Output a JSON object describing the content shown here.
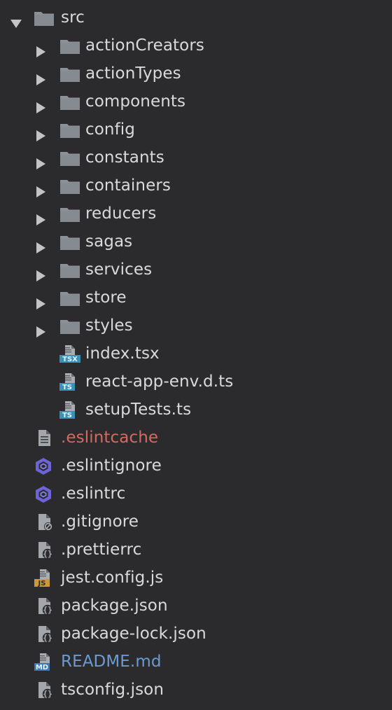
{
  "tree": {
    "root": {
      "name": "src",
      "icon": "folder-icon",
      "expanded": true
    },
    "folders": [
      {
        "name": "actionCreators",
        "icon": "folder-icon"
      },
      {
        "name": "actionTypes",
        "icon": "folder-icon"
      },
      {
        "name": "components",
        "icon": "folder-icon"
      },
      {
        "name": "config",
        "icon": "folder-icon"
      },
      {
        "name": "constants",
        "icon": "folder-icon"
      },
      {
        "name": "containers",
        "icon": "folder-icon"
      },
      {
        "name": "reducers",
        "icon": "folder-icon"
      },
      {
        "name": "sagas",
        "icon": "folder-icon"
      },
      {
        "name": "services",
        "icon": "folder-icon"
      },
      {
        "name": "store",
        "icon": "folder-icon"
      },
      {
        "name": "styles",
        "icon": "folder-icon"
      }
    ],
    "src_files": [
      {
        "name": "index.tsx",
        "icon": "tsx-file-icon",
        "badge": "TSX"
      },
      {
        "name": "react-app-env.d.ts",
        "icon": "ts-file-icon",
        "badge": "TS"
      },
      {
        "name": "setupTests.ts",
        "icon": "ts-file-icon",
        "badge": "TS"
      }
    ],
    "root_files": [
      {
        "name": ".eslintcache",
        "icon": "text-file-icon",
        "status": "unversioned"
      },
      {
        "name": ".eslintignore",
        "icon": "eslint-icon"
      },
      {
        "name": ".eslintrc",
        "icon": "eslint-icon"
      },
      {
        "name": ".gitignore",
        "icon": "ignore-file-icon"
      },
      {
        "name": ".prettierrc",
        "icon": "json-file-icon"
      },
      {
        "name": "jest.config.js",
        "icon": "js-file-icon",
        "badge": "JS"
      },
      {
        "name": "package.json",
        "icon": "json-file-icon"
      },
      {
        "name": "package-lock.json",
        "icon": "json-file-icon"
      },
      {
        "name": "README.md",
        "icon": "md-file-icon",
        "badge": "MD",
        "status": "modified"
      },
      {
        "name": "tsconfig.json",
        "icon": "json-file-icon"
      }
    ]
  },
  "colors": {
    "background": "#2b2b2d",
    "text": "#dadada",
    "unversioned": "#d6695f",
    "modified": "#6b9bd1",
    "folder": "#8b9196",
    "ts_badge": "#3c8fb5",
    "js_badge": "#c99a3a",
    "eslint": "#6d64d8"
  }
}
